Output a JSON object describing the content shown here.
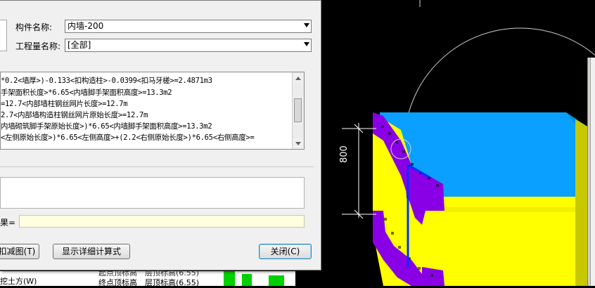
{
  "dialog": {
    "component_name_label": "构件名称:",
    "component_name_value": "内墙-200",
    "quantity_name_label": "工程量名称:",
    "quantity_name_value": "[全部]",
    "formula_lines": [
      "*0.2<墙厚>)-0.133<扣构造柱>-0.0399<扣马牙槎>=2.4871m3",
      "手架面积长度>*6.65<内墙脚手架面积高度>=13.3m2",
      "=12.7<内部墙柱钢丝网片长度>=12.7m",
      "2.7<内部墙构造柱钢丝网片原始长度>=12.7m",
      "内墙砌筑脚手架原始长度>)*6.65<内墙脚手架面积高度>=13.3m2",
      "<左侧原始长度>)*6.65<左侧高度>+(2.2<右侧原始长度>)*6.65<右侧高度>="
    ],
    "result_label": "果=",
    "result_value": "",
    "deduction_button": "扣减图(T)",
    "show_detail_button": "显示详细计算式",
    "close_button": "关闭(C)"
  },
  "viewport": {
    "dimension_label": "800"
  },
  "background_panel": {
    "row1": "挖土方(W)",
    "row2_col1": "终点顶标高",
    "row2_col2": "层顶标高(6.55)",
    "row0_col1": "起点顶标高",
    "row0_col2": "层顶标高(6.55)"
  },
  "colors": {
    "wall_yellow": "#ffff00",
    "wall_blue": "#0aa0ff",
    "wall_purple": "#8a00e6",
    "background": "#000000"
  }
}
